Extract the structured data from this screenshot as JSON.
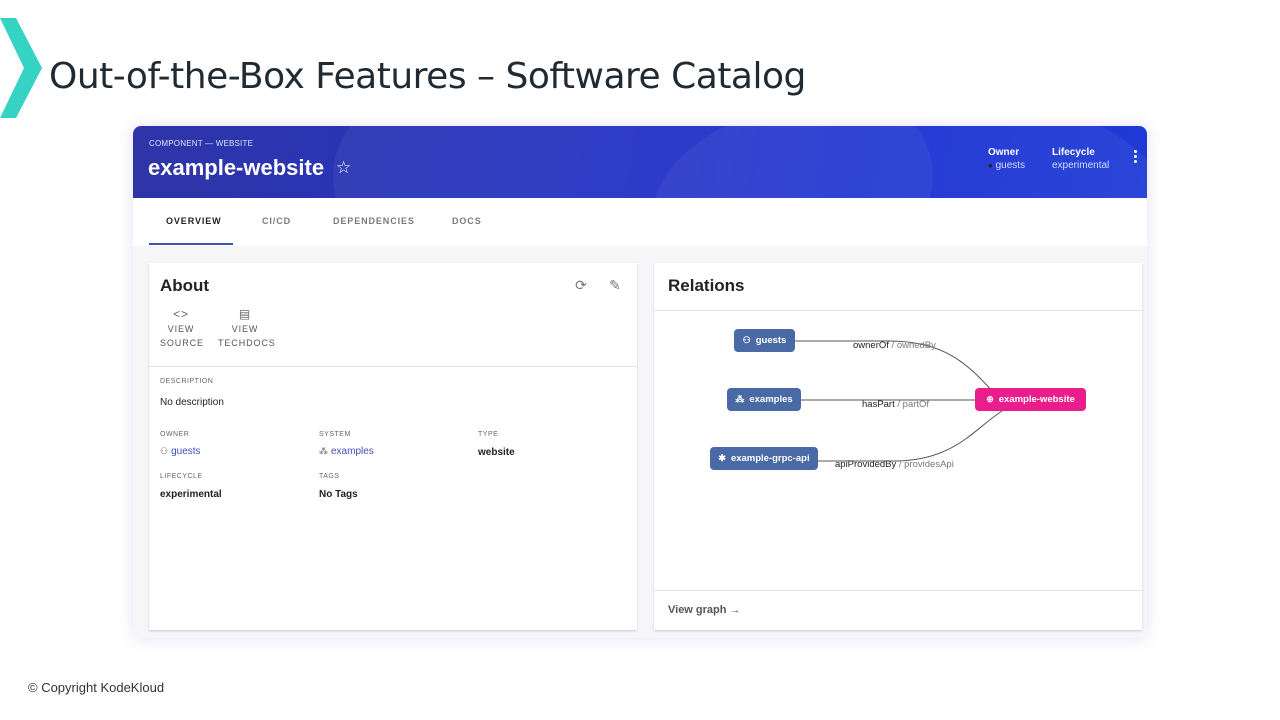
{
  "slide": {
    "title": "Out-of-the-Box Features – Software Catalog",
    "copyright": "© Copyright KodeKloud",
    "colors": {
      "accent_teal": "#38d9c7",
      "header_blue": "#2634c0",
      "node_blue": "#4a6aa5",
      "node_pink": "#e91e8c"
    }
  },
  "entity": {
    "kind_label": "COMPONENT — WEBSITE",
    "name": "example-website",
    "star_icon": "star-outline-icon",
    "owner_label": "Owner",
    "owner_value": "guests",
    "lifecycle_label": "Lifecycle",
    "lifecycle_value": "experimental"
  },
  "tabs": [
    {
      "label": "OVERVIEW",
      "active": true
    },
    {
      "label": "CI/CD",
      "active": false
    },
    {
      "label": "DEPENDENCIES",
      "active": false
    },
    {
      "label": "DOCS",
      "active": false
    }
  ],
  "about": {
    "title": "About",
    "view_source": [
      "VIEW",
      "SOURCE"
    ],
    "view_techdocs": [
      "VIEW",
      "TECHDOCS"
    ],
    "description_label": "DESCRIPTION",
    "description_value": "No description",
    "owner_label": "OWNER",
    "owner_value": "guests",
    "system_label": "SYSTEM",
    "system_value": "examples",
    "type_label": "TYPE",
    "type_value": "website",
    "lifecycle_label": "LIFECYCLE",
    "lifecycle_value": "experimental",
    "tags_label": "TAGS",
    "tags_value": "No Tags"
  },
  "relations": {
    "title": "Relations",
    "view_graph": "View graph",
    "nodes": {
      "guests": "guests",
      "examples": "examples",
      "api": "example-grpc-api",
      "website": "example-website"
    },
    "edges": [
      {
        "label": "ownerOf",
        "inverse": " / ownedBy"
      },
      {
        "label": "hasPart",
        "inverse": " / partOf"
      },
      {
        "label": "apiProvidedBy",
        "inverse": " / providesApi"
      }
    ]
  }
}
